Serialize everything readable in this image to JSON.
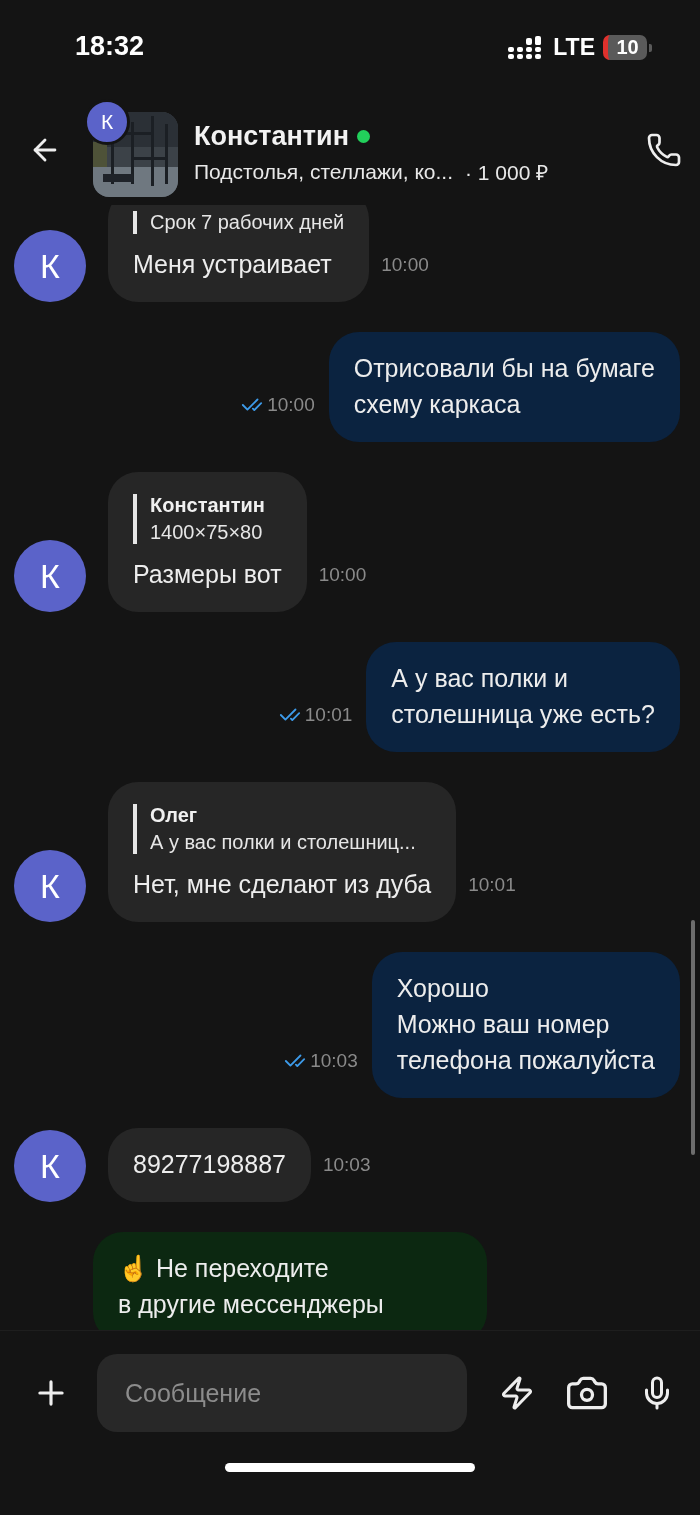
{
  "status_bar": {
    "time": "18:32",
    "network": "LTE",
    "battery": "10"
  },
  "header": {
    "avatar_letter": "К",
    "name": "Константин",
    "online": true,
    "subtitle": "Подстолья, стеллажи, ко...",
    "price": "· 1 000 ₽"
  },
  "messages": [
    {
      "kind": "in",
      "avatar_letter": "К",
      "quote": {
        "text": "Срок 7 рабочих дней"
      },
      "text": "Меня устраивает",
      "time": "10:00"
    },
    {
      "kind": "out",
      "text": "Отрисовали бы на бумаге\nсхему каркаса",
      "time": "10:00",
      "read": true
    },
    {
      "kind": "in",
      "avatar_letter": "К",
      "quote": {
        "author": "Константин",
        "text": "1400×75×80"
      },
      "text": "Размеры вот",
      "time": "10:00"
    },
    {
      "kind": "out",
      "text": "А у вас полки и\nстолешница уже есть?",
      "time": "10:01",
      "read": true
    },
    {
      "kind": "in",
      "avatar_letter": "К",
      "quote": {
        "author": "Олег",
        "text": "А у вас полки и столешниц..."
      },
      "text": "Нет, мне сделают из дуба",
      "time": "10:01"
    },
    {
      "kind": "out",
      "text": "Хорошо\nМожно ваш номер\nтелефона пожалуйста",
      "time": "10:03",
      "read": true
    },
    {
      "kind": "in",
      "avatar_letter": "К",
      "text": "89277198887",
      "time": "10:03"
    },
    {
      "kind": "notice",
      "text": "☝️ Не переходите\nв другие мессенджеры"
    }
  ],
  "composer": {
    "placeholder": "Сообщение"
  }
}
